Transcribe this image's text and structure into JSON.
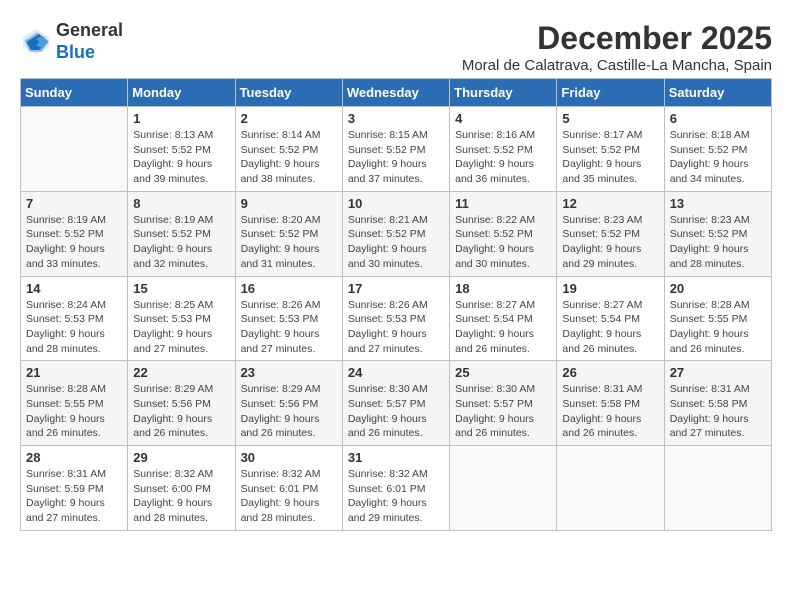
{
  "logo": {
    "line1": "General",
    "line2": "Blue"
  },
  "title": "December 2025",
  "location": "Moral de Calatrava, Castille-La Mancha, Spain",
  "days_of_week": [
    "Sunday",
    "Monday",
    "Tuesday",
    "Wednesday",
    "Thursday",
    "Friday",
    "Saturday"
  ],
  "weeks": [
    [
      {
        "day": "",
        "content": ""
      },
      {
        "day": "1",
        "content": "Sunrise: 8:13 AM\nSunset: 5:52 PM\nDaylight: 9 hours\nand 39 minutes."
      },
      {
        "day": "2",
        "content": "Sunrise: 8:14 AM\nSunset: 5:52 PM\nDaylight: 9 hours\nand 38 minutes."
      },
      {
        "day": "3",
        "content": "Sunrise: 8:15 AM\nSunset: 5:52 PM\nDaylight: 9 hours\nand 37 minutes."
      },
      {
        "day": "4",
        "content": "Sunrise: 8:16 AM\nSunset: 5:52 PM\nDaylight: 9 hours\nand 36 minutes."
      },
      {
        "day": "5",
        "content": "Sunrise: 8:17 AM\nSunset: 5:52 PM\nDaylight: 9 hours\nand 35 minutes."
      },
      {
        "day": "6",
        "content": "Sunrise: 8:18 AM\nSunset: 5:52 PM\nDaylight: 9 hours\nand 34 minutes."
      }
    ],
    [
      {
        "day": "7",
        "content": "Sunrise: 8:19 AM\nSunset: 5:52 PM\nDaylight: 9 hours\nand 33 minutes."
      },
      {
        "day": "8",
        "content": "Sunrise: 8:19 AM\nSunset: 5:52 PM\nDaylight: 9 hours\nand 32 minutes."
      },
      {
        "day": "9",
        "content": "Sunrise: 8:20 AM\nSunset: 5:52 PM\nDaylight: 9 hours\nand 31 minutes."
      },
      {
        "day": "10",
        "content": "Sunrise: 8:21 AM\nSunset: 5:52 PM\nDaylight: 9 hours\nand 30 minutes."
      },
      {
        "day": "11",
        "content": "Sunrise: 8:22 AM\nSunset: 5:52 PM\nDaylight: 9 hours\nand 30 minutes."
      },
      {
        "day": "12",
        "content": "Sunrise: 8:23 AM\nSunset: 5:52 PM\nDaylight: 9 hours\nand 29 minutes."
      },
      {
        "day": "13",
        "content": "Sunrise: 8:23 AM\nSunset: 5:52 PM\nDaylight: 9 hours\nand 28 minutes."
      }
    ],
    [
      {
        "day": "14",
        "content": "Sunrise: 8:24 AM\nSunset: 5:53 PM\nDaylight: 9 hours\nand 28 minutes."
      },
      {
        "day": "15",
        "content": "Sunrise: 8:25 AM\nSunset: 5:53 PM\nDaylight: 9 hours\nand 27 minutes."
      },
      {
        "day": "16",
        "content": "Sunrise: 8:26 AM\nSunset: 5:53 PM\nDaylight: 9 hours\nand 27 minutes."
      },
      {
        "day": "17",
        "content": "Sunrise: 8:26 AM\nSunset: 5:53 PM\nDaylight: 9 hours\nand 27 minutes."
      },
      {
        "day": "18",
        "content": "Sunrise: 8:27 AM\nSunset: 5:54 PM\nDaylight: 9 hours\nand 26 minutes."
      },
      {
        "day": "19",
        "content": "Sunrise: 8:27 AM\nSunset: 5:54 PM\nDaylight: 9 hours\nand 26 minutes."
      },
      {
        "day": "20",
        "content": "Sunrise: 8:28 AM\nSunset: 5:55 PM\nDaylight: 9 hours\nand 26 minutes."
      }
    ],
    [
      {
        "day": "21",
        "content": "Sunrise: 8:28 AM\nSunset: 5:55 PM\nDaylight: 9 hours\nand 26 minutes."
      },
      {
        "day": "22",
        "content": "Sunrise: 8:29 AM\nSunset: 5:56 PM\nDaylight: 9 hours\nand 26 minutes."
      },
      {
        "day": "23",
        "content": "Sunrise: 8:29 AM\nSunset: 5:56 PM\nDaylight: 9 hours\nand 26 minutes."
      },
      {
        "day": "24",
        "content": "Sunrise: 8:30 AM\nSunset: 5:57 PM\nDaylight: 9 hours\nand 26 minutes."
      },
      {
        "day": "25",
        "content": "Sunrise: 8:30 AM\nSunset: 5:57 PM\nDaylight: 9 hours\nand 26 minutes."
      },
      {
        "day": "26",
        "content": "Sunrise: 8:31 AM\nSunset: 5:58 PM\nDaylight: 9 hours\nand 26 minutes."
      },
      {
        "day": "27",
        "content": "Sunrise: 8:31 AM\nSunset: 5:58 PM\nDaylight: 9 hours\nand 27 minutes."
      }
    ],
    [
      {
        "day": "28",
        "content": "Sunrise: 8:31 AM\nSunset: 5:59 PM\nDaylight: 9 hours\nand 27 minutes."
      },
      {
        "day": "29",
        "content": "Sunrise: 8:32 AM\nSunset: 6:00 PM\nDaylight: 9 hours\nand 28 minutes."
      },
      {
        "day": "30",
        "content": "Sunrise: 8:32 AM\nSunset: 6:01 PM\nDaylight: 9 hours\nand 28 minutes."
      },
      {
        "day": "31",
        "content": "Sunrise: 8:32 AM\nSunset: 6:01 PM\nDaylight: 9 hours\nand 29 minutes."
      },
      {
        "day": "",
        "content": ""
      },
      {
        "day": "",
        "content": ""
      },
      {
        "day": "",
        "content": ""
      }
    ]
  ]
}
